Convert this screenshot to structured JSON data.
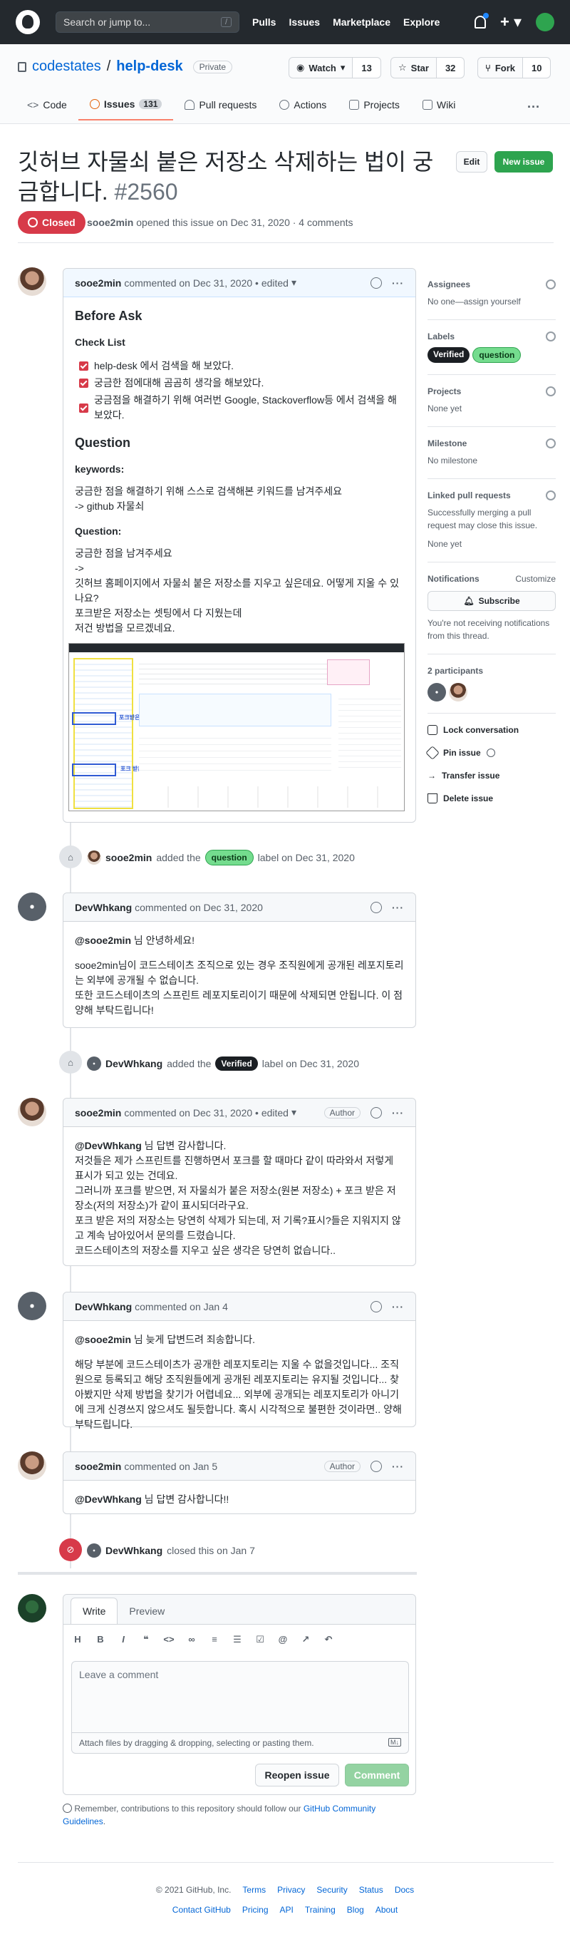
{
  "header": {
    "search_placeholder": "Search or jump to...",
    "search_shortcut": "/",
    "nav": [
      "Pulls",
      "Issues",
      "Marketplace",
      "Explore"
    ]
  },
  "repo": {
    "owner": "codestates",
    "separator": "/",
    "name": "help-desk",
    "visibility": "Private",
    "watch_label": "Watch",
    "watch_count": "13",
    "star_label": "Star",
    "star_count": "32",
    "fork_label": "Fork",
    "fork_count": "10"
  },
  "tabs": [
    {
      "label": "Code",
      "icon": "code-icon"
    },
    {
      "label": "Issues",
      "count": "131",
      "icon": "issue-icon",
      "selected": true
    },
    {
      "label": "Pull requests",
      "icon": "pull-request-icon"
    },
    {
      "label": "Actions",
      "icon": "play-icon"
    },
    {
      "label": "Projects",
      "icon": "project-icon"
    },
    {
      "label": "Wiki",
      "icon": "book-icon"
    }
  ],
  "issue": {
    "title": "깃허브 자물쇠 붙은 저장소 삭제하는 법이 궁금합니다.",
    "number": "#2560",
    "edit_label": "Edit",
    "new_issue_label": "New issue",
    "state": "Closed",
    "author": "sooe2min",
    "meta": "opened this issue on Dec 31, 2020 · 4 comments"
  },
  "first_comment": {
    "author": "sooe2min",
    "meta": "commented on Dec 31, 2020 • edited",
    "h_before": "Before Ask",
    "h_checklist": "Check List",
    "checks": [
      "help-desk 에서 검색을 해 보았다.",
      "궁금한 점에대해 곰곰히 생각을 해보았다.",
      "궁금점을 해결하기 위해 여러번 Google, Stackoverflow등 에서 검색을 해보았다."
    ],
    "h_question": "Question",
    "h_keywords": "keywords:",
    "keywords_line1": "궁금한 점을 해결하기 위해 스스로 검색해본 키워드를 남겨주세요",
    "keywords_line2": "-> github 자물쇠",
    "h_question2": "Question:",
    "q_line1": "궁금한 점을 남겨주세요",
    "q_line2": "->",
    "q_line3": "깃허브 홈페이지에서 자물쇠 붙은 저장소를 지우고 싶은데요. 어떻게 지울 수 있나요?",
    "q_line4": "포크받은 저장소는 셋팅에서 다 지웠는데",
    "q_line5": "저건 방법을 모르겠네요.",
    "shot_label1": "포크받은 왜 없는 자물쇠 저장소?",
    "shot_label2": "포크 받은 저장 저장소"
  },
  "event_label": {
    "author": "sooe2min",
    "pre": "added the",
    "label": "question",
    "post": "label on Dec 31, 2020"
  },
  "comment2": {
    "author": "DevWhkang",
    "meta": "commented on Dec 31, 2020",
    "mention": "@sooe2min",
    "line1": "님 안녕하세요!",
    "line2": "sooe2min님이 코드스테이츠 조직으로 있는 경우 조직원에게 공개된 레포지토리는 외부에 공개될 수 없습니다.",
    "line3": "또한 코드스테이츠의 스프린트 레포지토리이기 때문에 삭제되면 안됩니다. 이 점 양해 부탁드립니다!"
  },
  "event_verified": {
    "author": "DevWhkang",
    "pre": "added the",
    "label": "Verified",
    "post": "label on Dec 31, 2020"
  },
  "comment3": {
    "author": "sooe2min",
    "meta": "commented on Dec 31, 2020 • edited",
    "badge": "Author",
    "mention": "@DevWhkang",
    "line1": "님 답변 감사합니다.",
    "line2": "저것들은 제가 스프린트를 진행하면서 포크를 할 때마다 같이 따라와서 저렇게 표시가 되고 있는 건데요.",
    "line3": "그러니까 포크를 받으면, 저 자물쇠가 붙은 저장소(원본 저장소) + 포크 받은 저장소(저의 저장소)가 같이 표시되더라구요.",
    "line4": "포크 받은 저의 저장소는 당연히 삭제가 되는데, 저 기록?표시?들은 지워지지 않고 계속 남아있어서 문의를 드렸습니다.",
    "line5": "코드스테이츠의 저장소를 지우고 싶은 생각은 당연히 없습니다.."
  },
  "comment4": {
    "author": "DevWhkang",
    "meta": "commented on Jan 4",
    "mention": "@sooe2min",
    "line1": "님 늦게 답변드려 죄송합니다.",
    "line2": "해당 부분에 코드스테이츠가 공개한 레포지토리는 지울 수 없을것입니다... 조직원으로 등록되고 해당 조직원들에게 공개된 레포지토리는 유지될 것입니다... 찾아봤지만 삭제 방법을 찾기가 어렵네요... 외부에 공개되는 레포지토리가 아니기에 크게 신경쓰지 않으셔도 될듯합니다. 혹시 시각적으로 불편한 것이라면.. 양해 부탁드립니다."
  },
  "comment5": {
    "author": "sooe2min",
    "meta": "commented on Jan 5",
    "badge": "Author",
    "mention": "@DevWhkang",
    "line1": "님 답변 감사합니다!!"
  },
  "event_closed": {
    "author": "DevWhkang",
    "text": "closed this on Jan 7"
  },
  "composer": {
    "tab_write": "Write",
    "tab_preview": "Preview",
    "placeholder": "Leave a comment",
    "attach": "Attach files by dragging & dropping, selecting or pasting them.",
    "reopen": "Reopen issue",
    "comment": "Comment",
    "guideline_pre": "Remember, contributions to this repository should follow our",
    "guideline_link": "GitHub Community Guidelines",
    "guideline_post": "."
  },
  "sidebar": {
    "assignees_h": "Assignees",
    "assignees_v": "No one—assign yourself",
    "labels_h": "Labels",
    "label_verified": "Verified",
    "label_question": "question",
    "projects_h": "Projects",
    "projects_v": "None yet",
    "milestone_h": "Milestone",
    "milestone_v": "No milestone",
    "linked_h": "Linked pull requests",
    "linked_desc": "Successfully merging a pull request may close this issue.",
    "linked_v": "None yet",
    "notif_h": "Notifications",
    "notif_customize": "Customize",
    "subscribe": "Subscribe",
    "notif_desc": "You're not receiving notifications from this thread.",
    "participants": "2 participants",
    "lock": "Lock conversation",
    "pin": "Pin issue",
    "transfer": "Transfer issue",
    "delete": "Delete issue"
  },
  "footer": {
    "copyright": "© 2021 GitHub, Inc.",
    "row1": [
      "Terms",
      "Privacy",
      "Security",
      "Status",
      "Docs"
    ],
    "row2": [
      "Contact GitHub",
      "Pricing",
      "API",
      "Training",
      "Blog",
      "About"
    ]
  }
}
